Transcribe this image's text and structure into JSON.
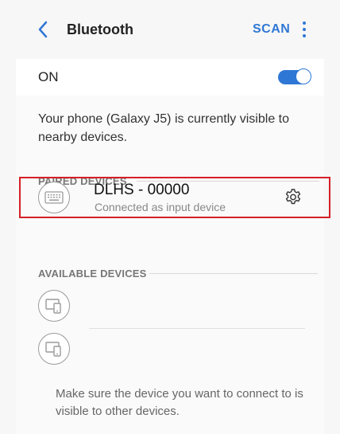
{
  "header": {
    "title": "Bluetooth",
    "scan_label": "SCAN"
  },
  "toggle": {
    "label": "ON",
    "state": "on"
  },
  "info_text": "Your phone (Galaxy J5) is currently visible to nearby devices.",
  "paired": {
    "header": "PAIRED DEVICES",
    "devices": [
      {
        "name": "DLHS - 00000",
        "status": "Connected as input device",
        "icon": "keyboard-icon"
      }
    ]
  },
  "available": {
    "header": "AVAILABLE DEVICES",
    "devices": [
      {
        "icon": "device-icon"
      },
      {
        "icon": "device-icon"
      }
    ]
  },
  "footer_text": "Make sure the device you want to connect to is visible to other devices.",
  "colors": {
    "accent": "#2f77d5",
    "highlight_border": "#d42027",
    "background": "#f7f7f7"
  }
}
